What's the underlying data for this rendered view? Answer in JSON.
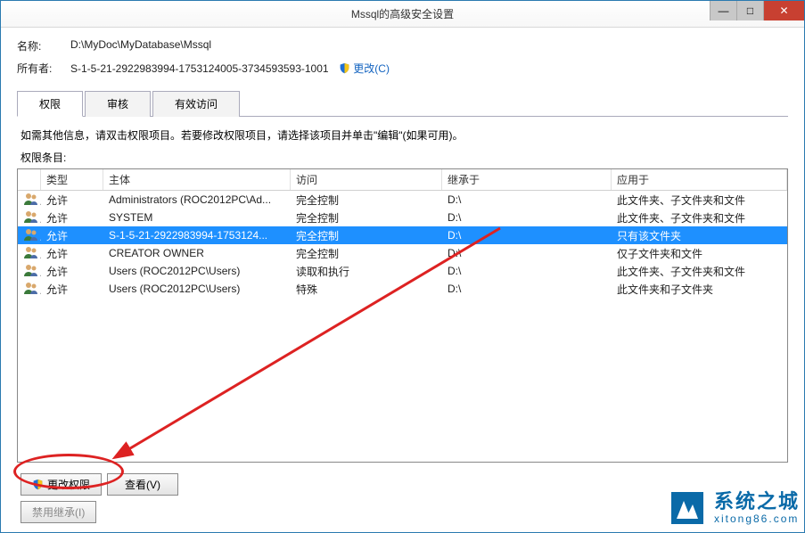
{
  "window": {
    "title": "Mssql的高级安全设置"
  },
  "name_field": {
    "label": "名称:",
    "value": "D:\\MyDoc\\MyDatabase\\Mssql"
  },
  "owner_field": {
    "label": "所有者:",
    "value": "S-1-5-21-2922983994-1753124005-3734593593-1001",
    "change": "更改(C)"
  },
  "tabs": {
    "t0": "权限",
    "t1": "审核",
    "t2": "有效访问"
  },
  "hint": "如需其他信息，请双击权限项目。若要修改权限项目，请选择该项目并单击\"编辑\"(如果可用)。",
  "list_label": "权限条目:",
  "columns": {
    "type": "类型",
    "principal": "主体",
    "access": "访问",
    "inherit": "继承于",
    "apply": "应用于"
  },
  "rows": [
    {
      "type": "允许",
      "principal": "Administrators (ROC2012PC\\Ad...",
      "access": "完全控制",
      "inherit": "D:\\",
      "apply": "此文件夹、子文件夹和文件",
      "selected": false
    },
    {
      "type": "允许",
      "principal": "SYSTEM",
      "access": "完全控制",
      "inherit": "D:\\",
      "apply": "此文件夹、子文件夹和文件",
      "selected": false
    },
    {
      "type": "允许",
      "principal": "S-1-5-21-2922983994-1753124...",
      "access": "完全控制",
      "inherit": "D:\\",
      "apply": "只有该文件夹",
      "selected": true
    },
    {
      "type": "允许",
      "principal": "CREATOR OWNER",
      "access": "完全控制",
      "inherit": "D:\\",
      "apply": "仅子文件夹和文件",
      "selected": false
    },
    {
      "type": "允许",
      "principal": "Users (ROC2012PC\\Users)",
      "access": "读取和执行",
      "inherit": "D:\\",
      "apply": "此文件夹、子文件夹和文件",
      "selected": false
    },
    {
      "type": "允许",
      "principal": "Users (ROC2012PC\\Users)",
      "access": "特殊",
      "inherit": "D:\\",
      "apply": "此文件夹和子文件夹",
      "selected": false
    }
  ],
  "buttons": {
    "change_perm": "更改权限",
    "view": "查看(V)",
    "disable_inherit": "禁用继承(I)"
  },
  "watermark": {
    "line1": "系统之城",
    "line2": "xitong86.com"
  }
}
